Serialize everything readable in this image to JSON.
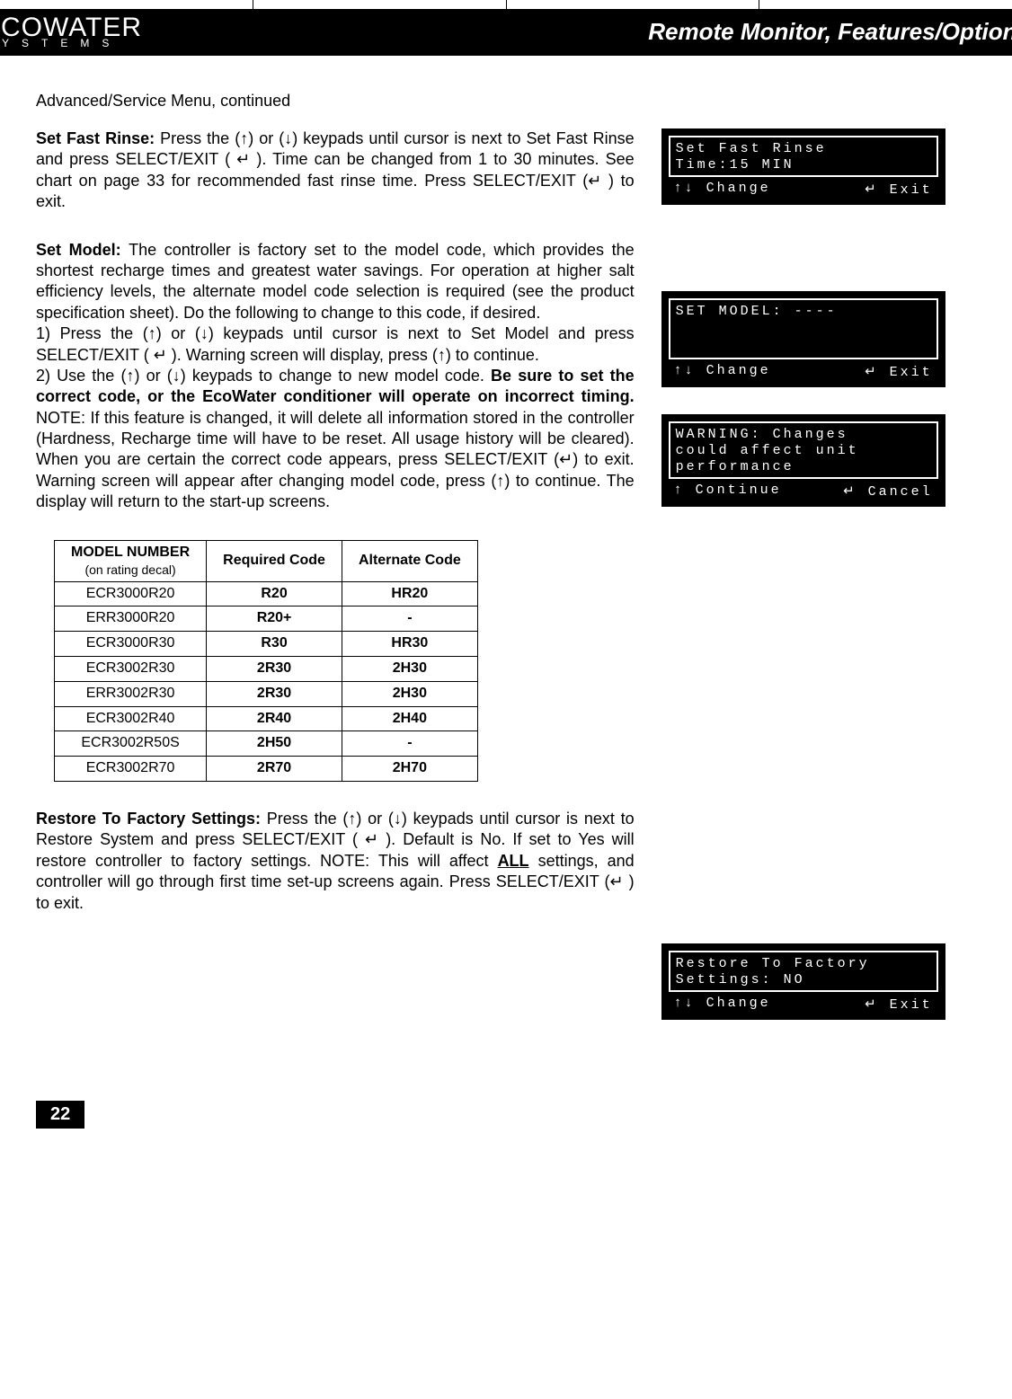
{
  "header": {
    "logo_main": "ECOWATER",
    "logo_sub": "SYSTEMS",
    "title": "Remote Monitor, Features/Options"
  },
  "continued": "Advanced/Service Menu, continued",
  "fast_rinse": {
    "title": "Set Fast Rinse: ",
    "body": "Press the (↑) or (↓) keypads until cursor is next to Set Fast Rinse and press SELECT/EXIT ( ↵ ).  Time can be changed from 1 to 30 minutes.  See chart on page 33 for recommended fast rinse time.  Press SELECT/EXIT (↵ ) to exit."
  },
  "set_model": {
    "title": "Set Model:  ",
    "body1": "The controller is factory set to the model code, which provides the shortest recharge times and greatest water savings. For operation at higher salt efficiency levels, the alternate model code selection is required (see the product specification sheet). Do the following to change to this code, if desired.",
    "body2": "1) Press the (↑) or (↓) keypads until cursor is next to Set Model and press SELECT/EXIT ( ↵ ).  Warning screen will display, press (↑) to continue.",
    "body3a": "2) Use the (↑) or (↓) keypads to change to new model code.  ",
    "body3b": "Be sure to set the correct code, or the EcoWater conditioner will operate on incorrect timing.",
    "body3c": " NOTE: If this feature is changed, it will delete all information stored in the controller (Hardness, Recharge time will have to be reset.  All usage history will be cleared).  When you are certain the correct code appears, press SELECT/EXIT (↵) to exit.  Warning screen will appear after changing model code, press (↑) to continue.  The display will return to the start-up screens."
  },
  "table": {
    "h1a": "MODEL NUMBER",
    "h1b": "(on rating decal)",
    "h2": "Required Code",
    "h3": "Alternate Code",
    "rows": [
      {
        "m": "ECR3000R20",
        "r": "R20",
        "a": "HR20"
      },
      {
        "m": "ERR3000R20",
        "r": "R20+",
        "a": "-"
      },
      {
        "m": "ECR3000R30",
        "r": "R30",
        "a": "HR30"
      },
      {
        "m": "ECR3002R30",
        "r": "2R30",
        "a": "2H30"
      },
      {
        "m": "ERR3002R30",
        "r": "2R30",
        "a": "2H30"
      },
      {
        "m": "ECR3002R40",
        "r": "2R40",
        "a": "2H40"
      },
      {
        "m": "ECR3002R50S",
        "r": "2H50",
        "a": "-"
      },
      {
        "m": "ECR3002R70",
        "r": "2R70",
        "a": "2H70"
      }
    ]
  },
  "restore": {
    "title": "Restore To Factory Settings: ",
    "body_a": "Press the (↑) or (↓) keypads until cursor is next to Restore System and press SELECT/EXIT ( ↵ ).  Default is No.  If set to Yes will restore controller to factory settings.  NOTE: This will affect ",
    "body_all": "ALL",
    "body_b": " settings, and controller will go through first time set-up screens again.  Press SELECT/EXIT (↵ ) to exit."
  },
  "lcd1": {
    "l1": "Set Fast Rinse",
    "l2": "Time:15 MIN",
    "fl": "↑↓ Change",
    "fr": "↵ Exit"
  },
  "lcd2": {
    "l1": "SET MODEL: ----",
    "fl": "↑↓ Change",
    "fr": "↵ Exit"
  },
  "lcd3": {
    "l1": "WARNING: Changes",
    "l2": "could affect unit",
    "l3": "performance",
    "fl": "↑ Continue",
    "fr": "↵ Cancel"
  },
  "lcd4": {
    "l1": "Restore To Factory",
    "l2": "Settings: NO",
    "fl": "↑↓ Change",
    "fr": "↵ Exit"
  },
  "page_number": "22"
}
